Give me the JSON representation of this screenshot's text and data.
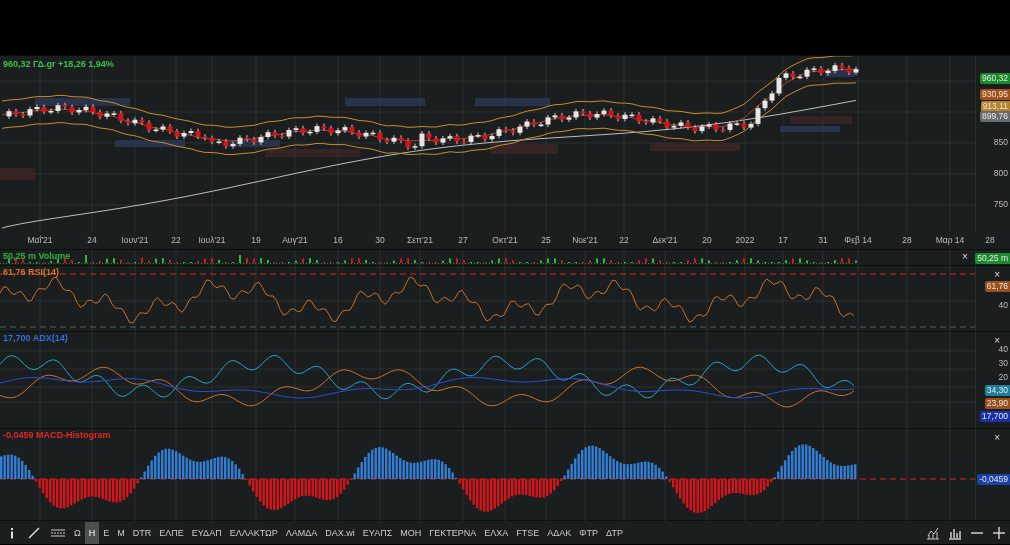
{
  "main_chart": {
    "legend": "960,32 ΓΔ.gr +18,26 1,94%",
    "price_labels": [
      {
        "text": "960,32",
        "color": "#1e8a2e"
      },
      {
        "text": "930,95",
        "color": "#a0521a"
      },
      {
        "text": "913,11",
        "color": "#b7832a"
      },
      {
        "text": "899,76",
        "color": "#6b6b6b"
      }
    ],
    "axis_ticks": [
      "850",
      "800",
      "750"
    ]
  },
  "x_axis": [
    "Μαΐ'21",
    "24",
    "Ιουν'21",
    "22",
    "Ιουλ'21",
    "19",
    "Αυγ'21",
    "16",
    "30",
    "Σεπ'21",
    "27",
    "Οκτ'21",
    "25",
    "Νοε'21",
    "22",
    "Δεκ'21",
    "20",
    "2022",
    "17",
    "31",
    "Φεβ 14",
    "28",
    "Μαρ 14",
    "28"
  ],
  "panels": [
    {
      "kind": "volume",
      "legend": "50,25 m Volume",
      "color": "#2fb53c",
      "close": "×",
      "value_labels": [
        {
          "text": "50,25 m",
          "color": "#1e8a2e"
        }
      ]
    },
    {
      "kind": "rsi",
      "legend": "61,76 RSI(14)",
      "color": "#d4772a",
      "close": "×",
      "value_labels": [
        {
          "text": "61,76",
          "color": "#9a4f1c"
        }
      ],
      "axis_ticks": [
        "40"
      ]
    },
    {
      "kind": "adx",
      "legend": "17,700 ADX(14)",
      "color": "#2f6fe0",
      "close": "×",
      "value_labels": [
        {
          "text": "34,30",
          "color": "#1f7f9a"
        },
        {
          "text": "23,90",
          "color": "#9a4f1c"
        },
        {
          "text": "17,700",
          "color": "#1a2fa8"
        }
      ],
      "axis_ticks": [
        "40",
        "30",
        "20"
      ]
    },
    {
      "kind": "macd",
      "legend": "-0,0459 MACD-Histogram",
      "color": "#e02828",
      "close": "×",
      "value_labels": [
        {
          "text": "-0,0459",
          "color": "#1a3fa8"
        }
      ]
    }
  ],
  "toolbar": {
    "symbols": [
      {
        "label": "Ω",
        "selected": false
      },
      {
        "label": "Η",
        "selected": true
      },
      {
        "label": "Ε",
        "selected": false
      },
      {
        "label": "Μ",
        "selected": false
      },
      {
        "label": "DTR",
        "selected": false
      },
      {
        "label": "ΕΛΠΕ",
        "selected": false
      },
      {
        "label": "ΕΥΔΑΠ",
        "selected": false
      },
      {
        "label": "ΕΛΛΑΚΤΩΡ",
        "selected": false
      },
      {
        "label": "ΛΑΜΔΑ",
        "selected": false
      },
      {
        "label": "DAX.wi",
        "selected": false
      },
      {
        "label": "ΕΥΑΠΣ",
        "selected": false
      },
      {
        "label": "ΜΟΗ",
        "selected": false
      },
      {
        "label": "ΓΕΚΤΕΡΝΑ",
        "selected": false
      },
      {
        "label": "ΕΛΧΑ",
        "selected": false
      },
      {
        "label": "FTSE",
        "selected": false
      },
      {
        "label": "ΑΔΑΚ",
        "selected": false
      },
      {
        "label": "ΦΤΡ",
        "selected": false
      },
      {
        "label": "ΔΤΡ",
        "selected": false
      }
    ]
  }
}
